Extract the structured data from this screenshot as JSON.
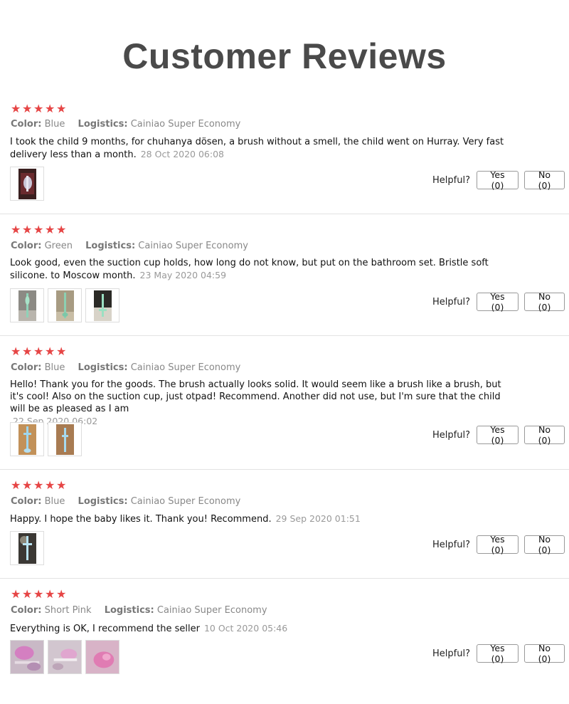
{
  "page": {
    "title": "Customer Reviews"
  },
  "labels": {
    "color_key": "Color:",
    "logistics_key": "Logistics:",
    "helpful": "Helpful?",
    "star_glyph": "★"
  },
  "reviews": [
    {
      "rating": 5,
      "color": "Blue",
      "logistics": "Cainiao Super Economy",
      "text": "I took the child 9 months, for chuhanya dösen, a brush without a smell, the child went on Hurray. Very fast delivery less than a month.",
      "date": "28 Oct 2020 06:08",
      "yes_label": "Yes (0)",
      "no_label": "No (0)",
      "photos": [
        "dark-red"
      ]
    },
    {
      "rating": 5,
      "color": "Green",
      "logistics": "Cainiao Super Economy",
      "text": "Look good, even the suction cup holds, how long do not know, but put on the bathroom set. Bristle soft silicone. to Moscow month.",
      "date": "23 May 2020 04:59",
      "yes_label": "Yes (0)",
      "no_label": "No (0)",
      "photos": [
        "grey-green",
        "tan-green",
        "dark-green"
      ]
    },
    {
      "rating": 5,
      "color": "Blue",
      "logistics": "Cainiao Super Economy",
      "text": "Hello! Thank you for the goods. The brush actually looks solid. It would seem like a brush like a brush, but it's cool! Also on the suction cup, just otpad! Recommend. Another did not use, but I'm sure that the child will be as pleased as I am",
      "date": "22 Sep 2020 06:02",
      "yes_label": "Yes (0)",
      "no_label": "No (0)",
      "photos": [
        "orange-blue",
        "brown-blue"
      ]
    },
    {
      "rating": 5,
      "color": "Blue",
      "logistics": "Cainiao Super Economy",
      "text": "Happy. I hope the baby likes it. Thank you! Recommend.",
      "date": "29 Sep 2020 01:51",
      "yes_label": "Yes (0)",
      "no_label": "No (0)",
      "photos": [
        "dark-blue"
      ]
    },
    {
      "rating": 5,
      "color": "Short Pink",
      "logistics": "Cainiao Super Economy",
      "text": "Everything is OK, I recommend the seller",
      "date": "10 Oct 2020 05:46",
      "yes_label": "Yes (0)",
      "no_label": "No (0)",
      "photos": [
        "pink-1",
        "pink-2",
        "pink-3"
      ]
    }
  ]
}
